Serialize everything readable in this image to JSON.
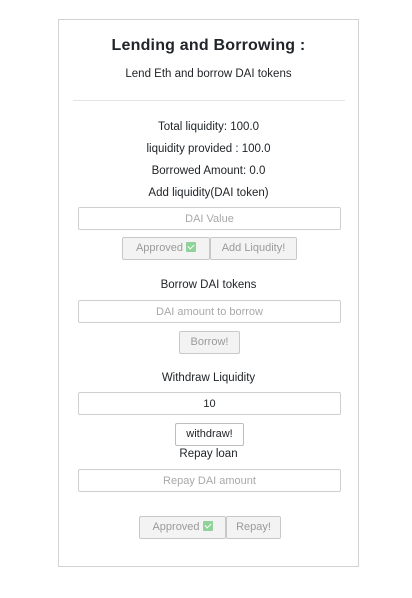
{
  "header": {
    "title": "Lending and Borrowing :",
    "subtitle": "Lend Eth and borrow DAI tokens"
  },
  "stats": {
    "total_liquidity": "Total liquidity: 100.0",
    "liquidity_provided": "liquidity provided : 100.0",
    "borrowed_amount": "Borrowed Amount: 0.0"
  },
  "add_liquidity": {
    "label": "Add liquidity(DAI token)",
    "input_placeholder": "DAI Value",
    "input_value": "",
    "approved_label": "Approved",
    "approved_icon": "check-box-icon",
    "add_button_label": "Add Liqudity!"
  },
  "borrow": {
    "label": "Borrow DAI tokens",
    "input_placeholder": "DAI amount to borrow",
    "input_value": "",
    "button_label": "Borrow!"
  },
  "withdraw": {
    "label": "Withdraw Liquidity",
    "input_value": "10",
    "button_label": "withdraw!"
  },
  "repay": {
    "label": "Repay loan",
    "input_placeholder": "Repay DAI amount",
    "input_value": "",
    "approved_label": "Approved",
    "approved_icon": "check-box-icon",
    "button_label": "Repay!"
  },
  "colors": {
    "check_green": "#8fd39b",
    "disabled_text": "#9a9a9a",
    "border": "#d3d3d3"
  }
}
